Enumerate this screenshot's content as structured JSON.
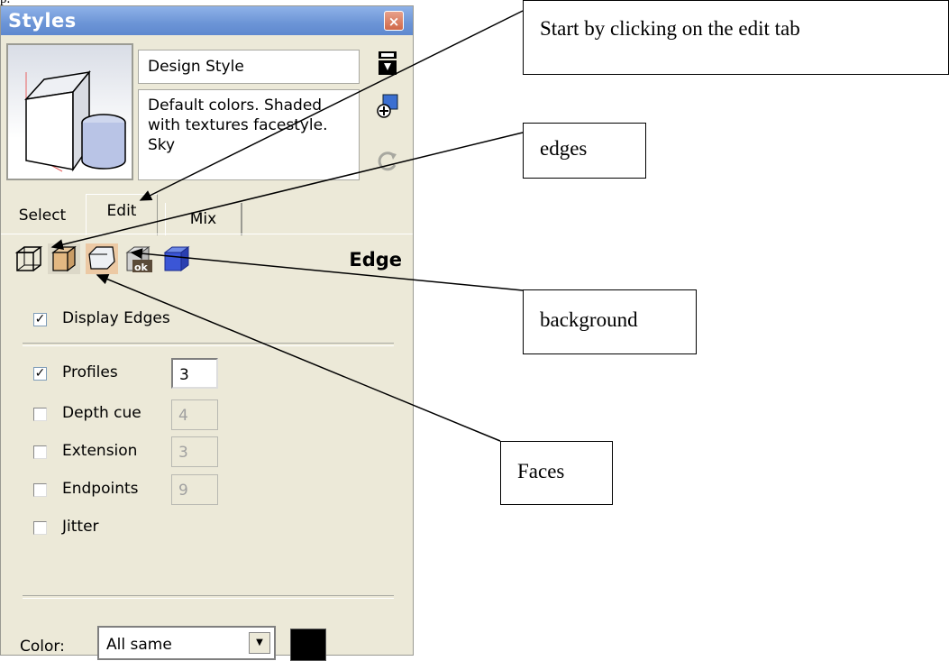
{
  "corner_text": "p.",
  "panel": {
    "title": "Styles",
    "close_symbol": "×",
    "style_name": "Design Style",
    "style_description": "Default colors.  Shaded with textures facestyle.  Sky",
    "tabs": [
      "Select",
      "Edit",
      "Mix"
    ],
    "toolbar_title": "Edge",
    "display_edges": {
      "label": "Display Edges",
      "checked": true
    },
    "options": [
      {
        "label": "Profiles",
        "checked": true,
        "value": "3",
        "enabled": true
      },
      {
        "label": "Depth cue",
        "checked": false,
        "value": "4",
        "enabled": false
      },
      {
        "label": "Extension",
        "checked": false,
        "value": "3",
        "enabled": false
      },
      {
        "label": "Endpoints",
        "checked": false,
        "value": "9",
        "enabled": false
      },
      {
        "label": "Jitter",
        "checked": false
      }
    ],
    "color_label": "Color:",
    "color_value": "All same",
    "color_swatch": "#000000"
  },
  "callouts": {
    "edit_tab": "Start by clicking on the edit tab",
    "edges": "edges",
    "background": "background",
    "faces": "Faces"
  },
  "icons": [
    "close-icon",
    "model-preview-icon",
    "save-style-icon",
    "create-style-icon",
    "refresh-icon",
    "edge-settings-icon",
    "face-settings-icon",
    "background-settings-icon",
    "watermark-settings-icon",
    "modeling-settings-icon",
    "dropdown-arrow-icon"
  ]
}
